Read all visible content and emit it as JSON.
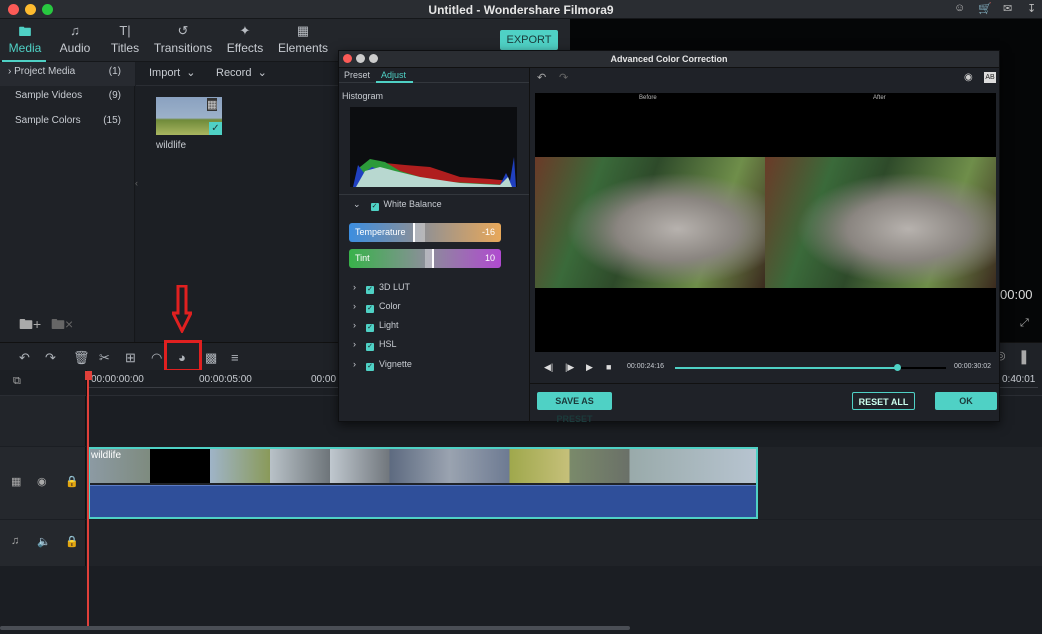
{
  "window": {
    "title": "Untitled - Wondershare Filmora9"
  },
  "top_tabs": [
    {
      "label": "Media",
      "icon": "folder-icon",
      "active": true
    },
    {
      "label": "Audio",
      "icon": "music-note-icon"
    },
    {
      "label": "Titles",
      "icon": "text-icon"
    },
    {
      "label": "Transitions",
      "icon": "transitions-icon"
    },
    {
      "label": "Effects",
      "icon": "effects-icon"
    },
    {
      "label": "Elements",
      "icon": "image-icon"
    }
  ],
  "export_label": "EXPORT",
  "header_icons": [
    "account-icon",
    "cart-icon",
    "mail-icon",
    "download-icon"
  ],
  "library": [
    {
      "label": "Project Media",
      "count": "(1)",
      "expanded": true
    },
    {
      "label": "Sample Videos",
      "count": "(9)"
    },
    {
      "label": "Sample Colors",
      "count": "(15)"
    }
  ],
  "media": {
    "import_label": "Import",
    "record_label": "Record",
    "items": [
      {
        "name": "wildlife",
        "selected": true
      }
    ]
  },
  "preview": {
    "time_partial": "00:00",
    "end_time_partial": "0:40:01"
  },
  "timeline": {
    "ticks": [
      "00:00:00:00",
      "00:00:05:00",
      "00:00"
    ],
    "clip_label": "wildlife",
    "highlighted_tool": "color-correction"
  },
  "dialog": {
    "title": "Advanced Color Correction",
    "tabs": [
      {
        "label": "Preset"
      },
      {
        "label": "Adjust",
        "active": true
      }
    ],
    "histogram_label": "Histogram",
    "white_balance": {
      "label": "White Balance",
      "checked": true,
      "expanded": true,
      "temperature": {
        "label": "Temperature",
        "value": "-16"
      },
      "tint": {
        "label": "Tint",
        "value": "10"
      }
    },
    "sections": [
      {
        "label": "3D LUT",
        "checked": true
      },
      {
        "label": "Color",
        "checked": true
      },
      {
        "label": "Light",
        "checked": true
      },
      {
        "label": "HSL",
        "checked": true
      },
      {
        "label": "Vignette",
        "checked": true
      }
    ],
    "before_label": "Before",
    "after_label": "After",
    "current_time": "00:00:24:16",
    "total_time": "00:00:30:02",
    "progress": 0.82,
    "save_preset_label": "SAVE AS PRESET",
    "reset_label": "RESET ALL",
    "ok_label": "OK"
  },
  "colors": {
    "accent": "#4fd1c5",
    "highlight": "#e02020",
    "clip_audio": "#2f4f9a"
  }
}
